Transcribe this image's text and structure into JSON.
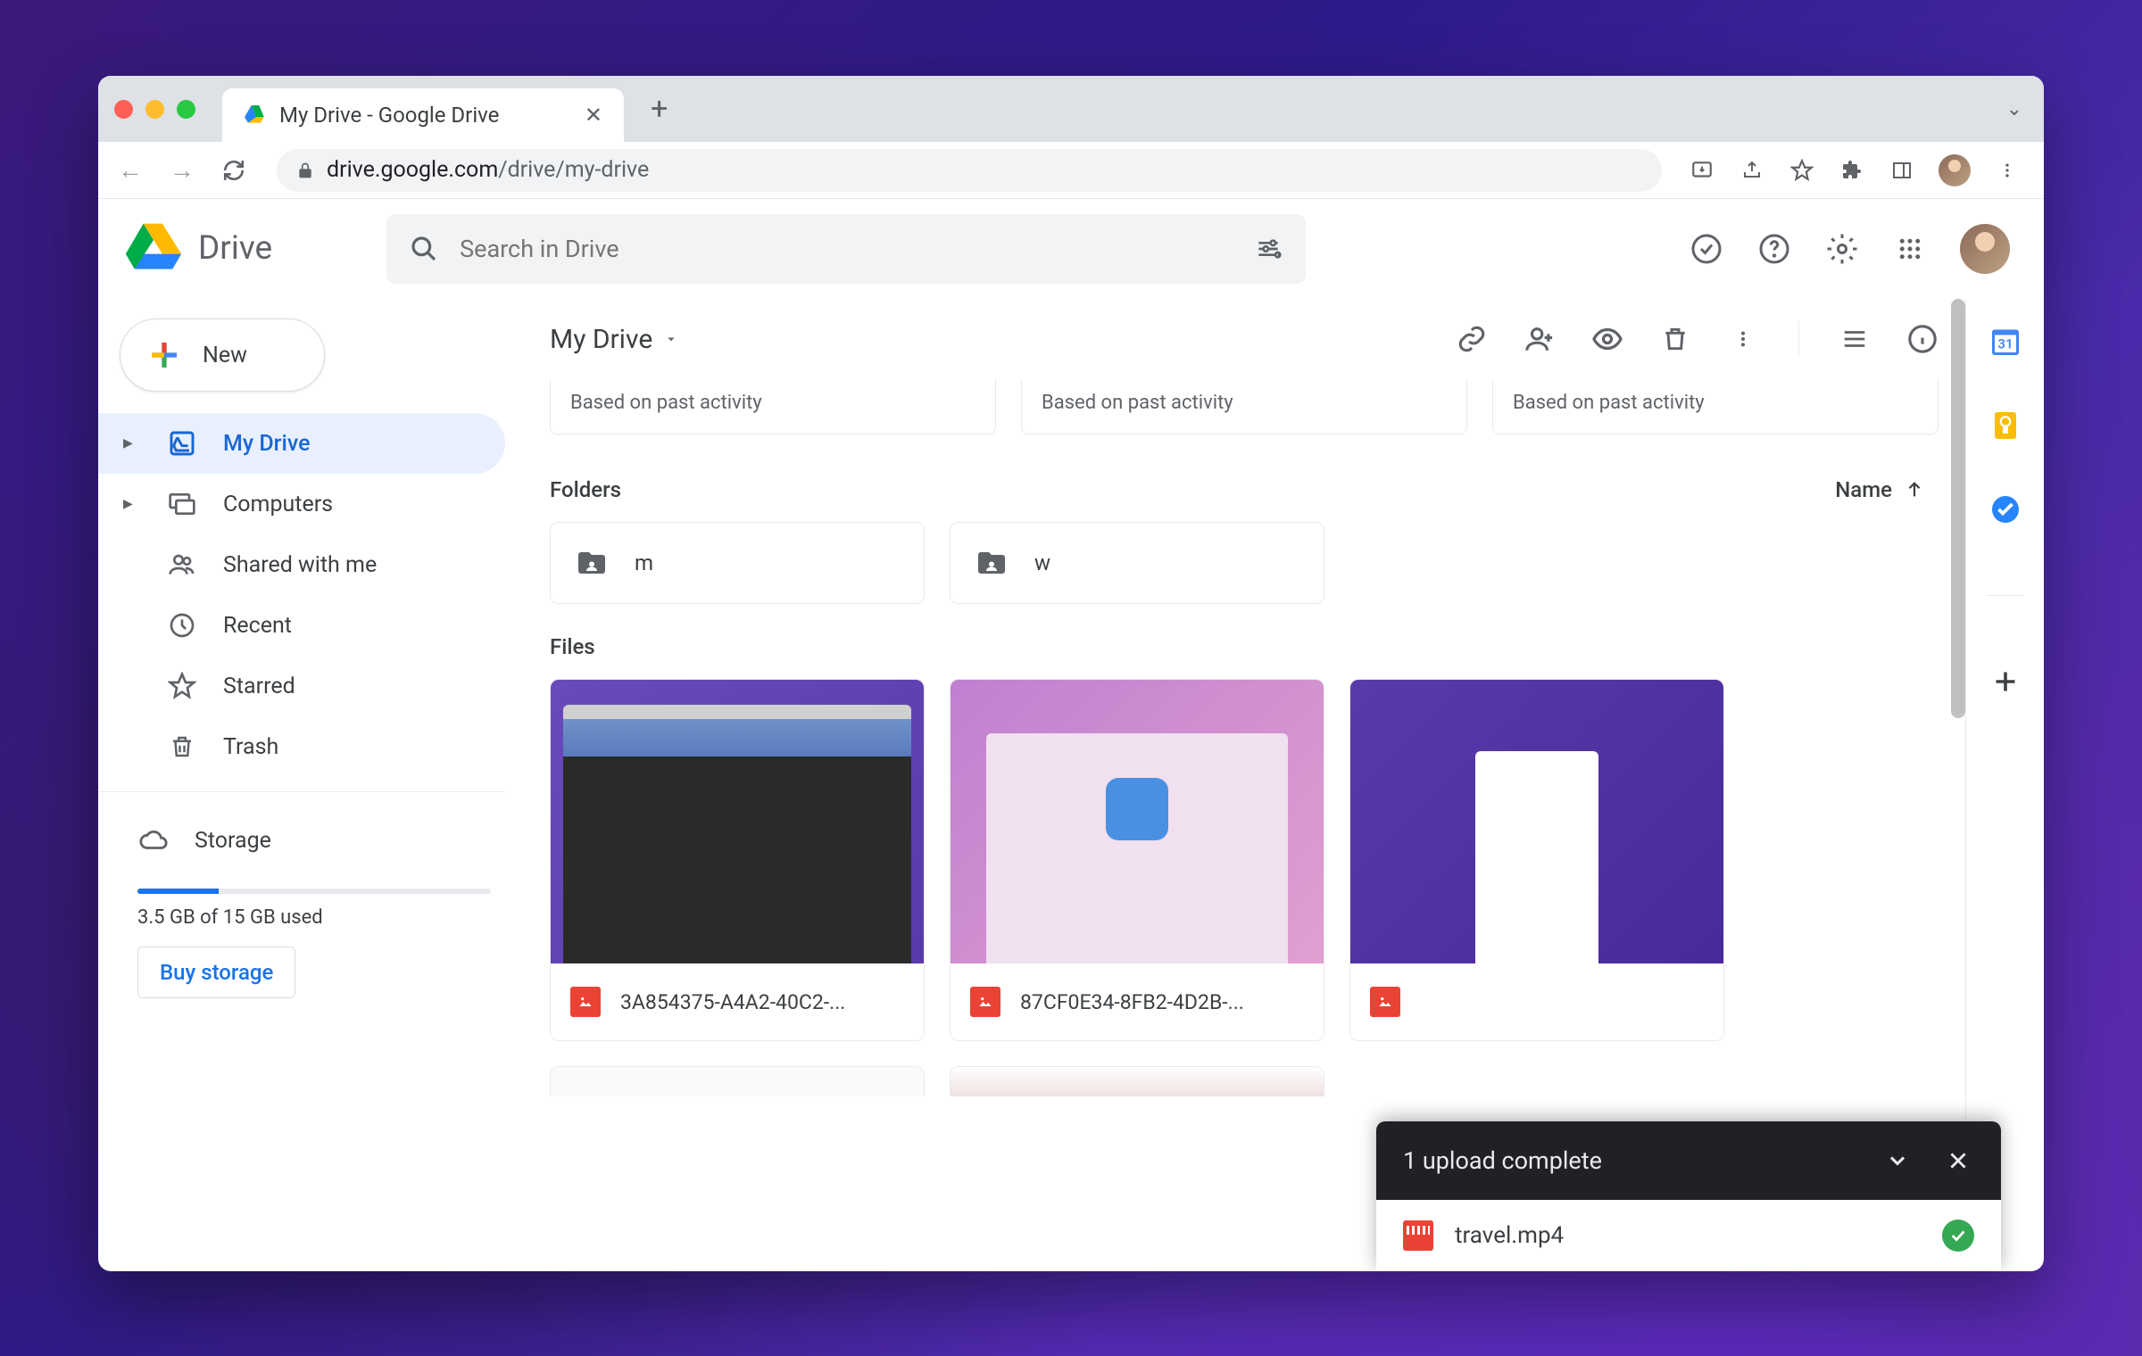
{
  "browser": {
    "tab_title": "My Drive - Google Drive",
    "url_host": "drive.google.com",
    "url_path": "/drive/my-drive"
  },
  "app": {
    "logo_text": "Drive",
    "search_placeholder": "Search in Drive"
  },
  "sidebar": {
    "new_label": "New",
    "items": [
      "My Drive",
      "Computers",
      "Shared with me",
      "Recent",
      "Starred",
      "Trash"
    ],
    "storage_label": "Storage",
    "storage_used": "3.5 GB of 15 GB used",
    "buy_label": "Buy storage"
  },
  "toolbar": {
    "breadcrumb": "My Drive"
  },
  "suggestions": {
    "hint": "Based on past activity"
  },
  "sections": {
    "folders": "Folders",
    "files": "Files",
    "sort_label": "Name"
  },
  "folders": [
    {
      "name": "m"
    },
    {
      "name": "w"
    }
  ],
  "files": [
    {
      "name": "3A854375-A4A2-40C2-..."
    },
    {
      "name": "87CF0E34-8FB2-4D2B-..."
    },
    {
      "name": ""
    }
  ],
  "toast": {
    "title": "1 upload complete",
    "file": "travel.mp4"
  }
}
